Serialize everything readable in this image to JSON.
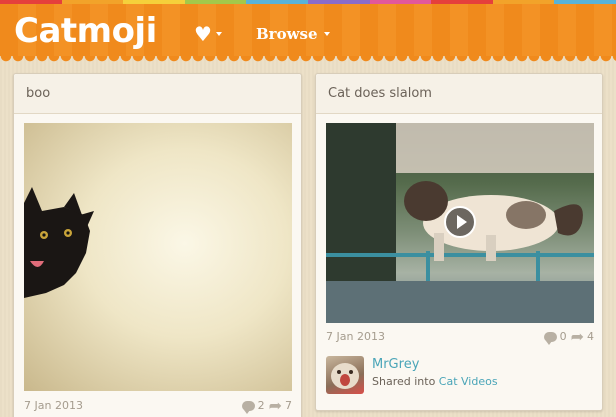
{
  "colors": {
    "header_orange": "#f08a1c",
    "link_teal": "#4aa5b8",
    "rainbow": [
      "#e5403c",
      "#f2a32a",
      "#f5d03b",
      "#a3c84a",
      "#59b3d8",
      "#8a6cc9",
      "#e2589a",
      "#e5403c",
      "#f2a32a",
      "#59b3d8"
    ]
  },
  "header": {
    "logo": "Catmoji",
    "heart_icon": "heart-icon",
    "browse_label": "Browse"
  },
  "cards": [
    {
      "title": "boo",
      "media_type": "image",
      "date": "7 Jan 2013",
      "comments": "2",
      "shares": "7"
    },
    {
      "title": "Cat does slalom",
      "media_type": "video",
      "date": "7 Jan 2013",
      "comments": "0",
      "shares": "4",
      "sharer": {
        "name": "MrGrey",
        "shared_prefix": "Shared into",
        "collection": "Cat Videos"
      }
    }
  ]
}
